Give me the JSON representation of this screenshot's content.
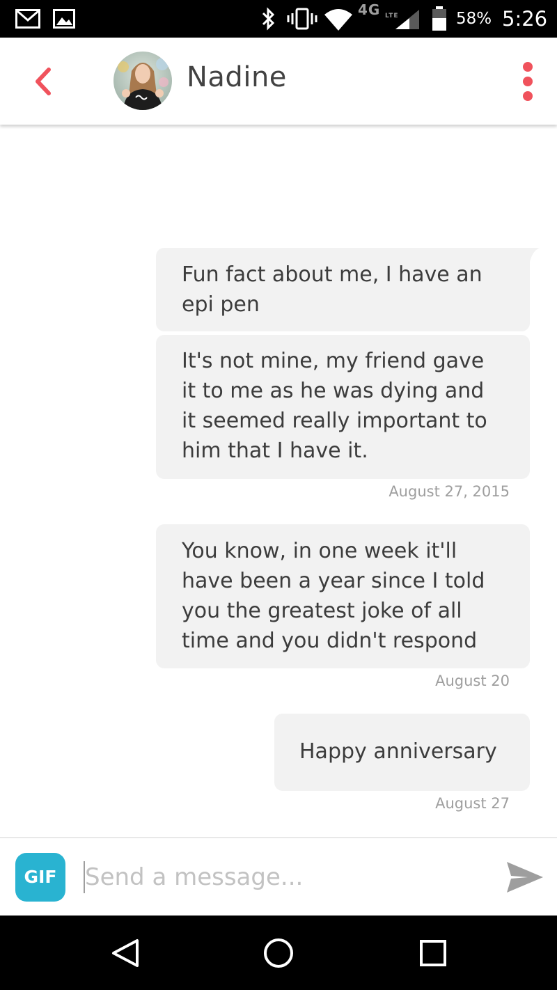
{
  "status_bar": {
    "battery": "58%",
    "time": "5:26",
    "network": "4G",
    "network_sub": "LTE",
    "icons": [
      "gmail-icon",
      "image-icon",
      "bluetooth-icon",
      "vibrate-icon",
      "wifi-icon",
      "signal-icon",
      "battery-icon"
    ]
  },
  "header": {
    "name": "Nadine",
    "back_icon": "chevron-left-icon",
    "menu_icon": "more-vertical-icon",
    "accent": "#f0525c"
  },
  "messages": [
    {
      "text": "Fun fact about me, I have an\nepi pen"
    },
    {
      "text": "It's not mine, my friend gave\nit to me as he was dying and\nit seemed really important to\nhim that I have it.",
      "timestamp": "August 27, 2015"
    },
    {
      "text": "You know, in one week it'll\nhave been a year since I told\nyou the greatest joke of all\ntime and you didn't respond",
      "timestamp": "August 20"
    },
    {
      "text": "Happy anniversary",
      "timestamp": "August 27"
    }
  ],
  "composer": {
    "gif_label": "GIF",
    "placeholder": "Send a message...",
    "gif_color": "#29b3d1",
    "send_icon": "send-icon"
  },
  "nav_bar": {
    "icons": [
      "back-triangle-icon",
      "home-circle-icon",
      "recents-square-icon"
    ]
  }
}
